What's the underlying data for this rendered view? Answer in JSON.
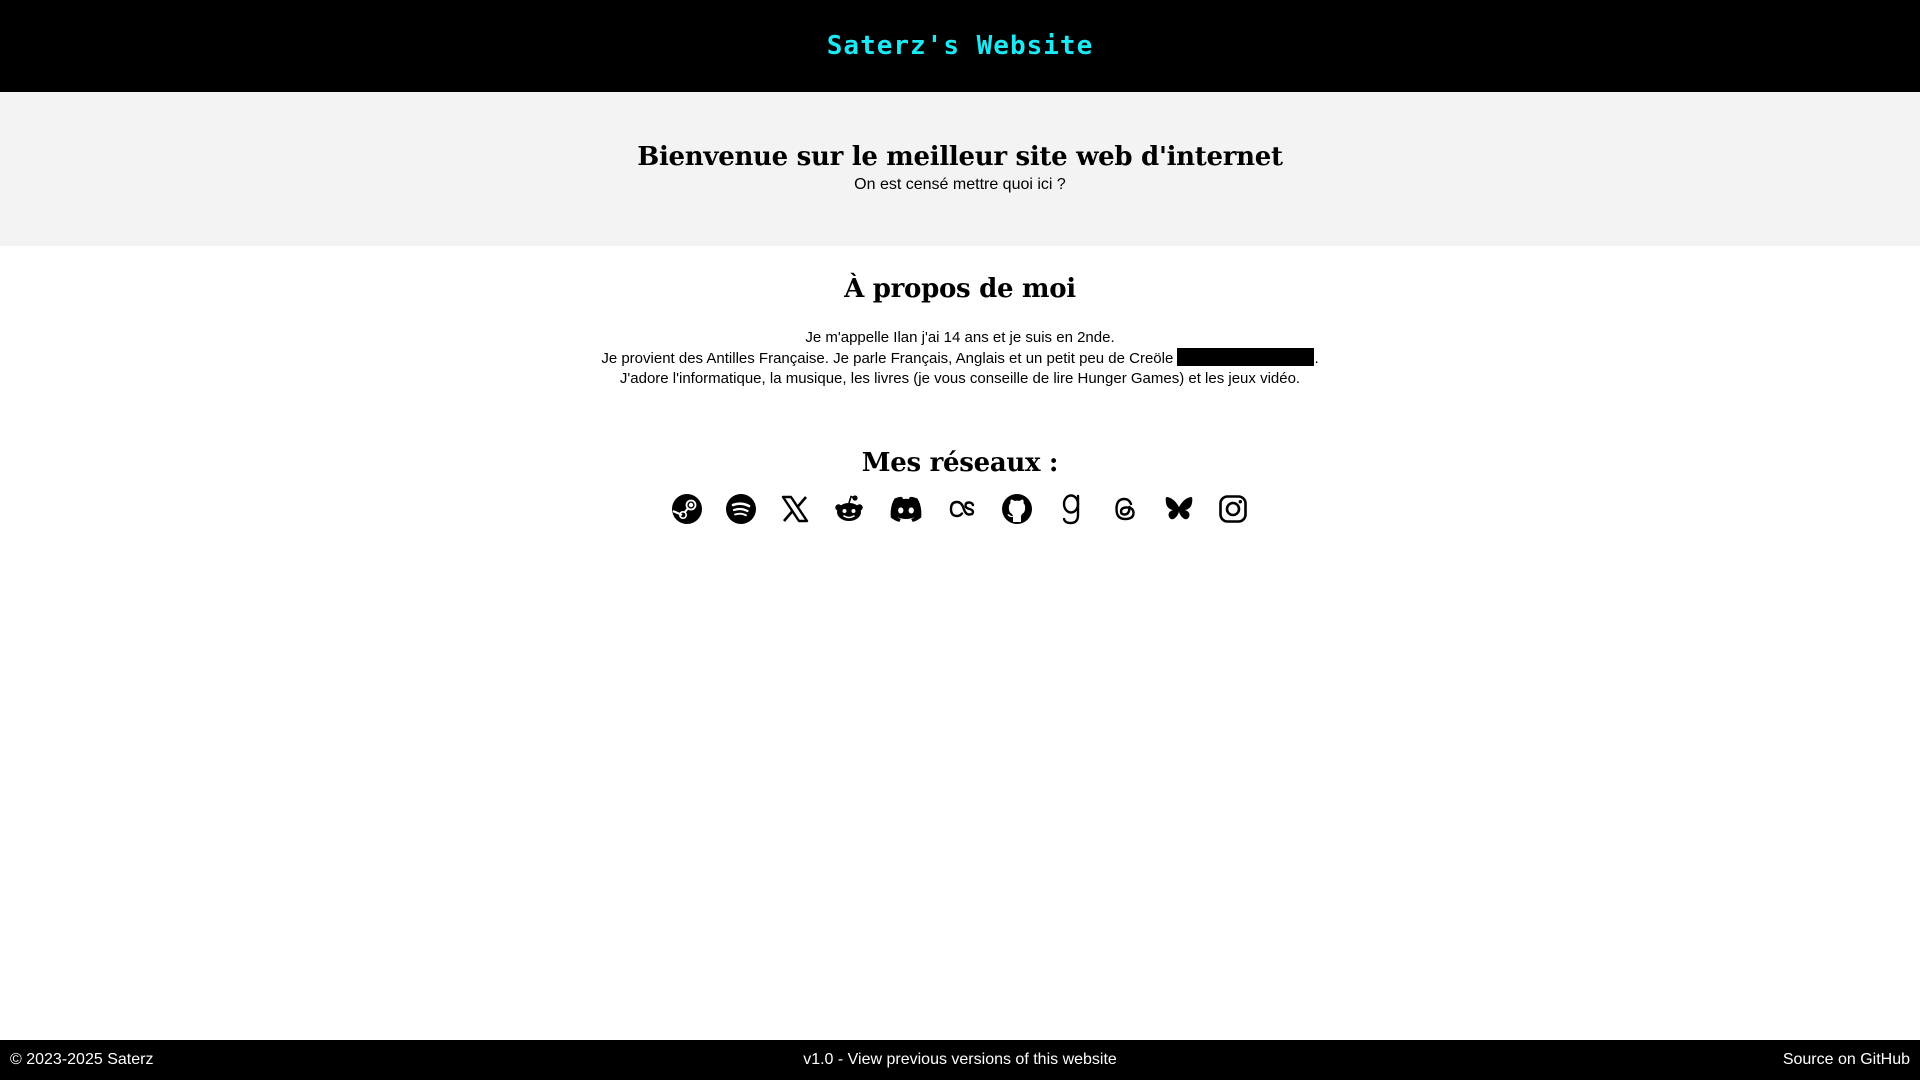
{
  "header": {
    "title": "Saterz's Website"
  },
  "hero": {
    "title": "Bienvenue sur le meilleur site web d'internet",
    "subtitle": "On est censé mettre quoi ici ?"
  },
  "about": {
    "title": "À propos de moi",
    "line1": "Je m'appelle Ilan j'ai 14 ans et je suis en 2nde.",
    "line2_before": "Je provient des Antilles Française. Je parle Français, Anglais et un petit peu de Creöle ",
    "line2_after": ".",
    "line3": "J'adore l'informatique, la musique, les livres (je vous conseille de lire Hunger Games) et les jeux vidéo."
  },
  "social": {
    "title": "Mes réseaux :",
    "icons": [
      "steam-icon",
      "spotify-icon",
      "x-icon",
      "reddit-icon",
      "discord-icon",
      "lastfm-icon",
      "github-icon",
      "goodreads-icon",
      "threads-icon",
      "bluesky-icon",
      "instagram-icon"
    ]
  },
  "footer": {
    "copyright": "© 2023-2025 Saterz",
    "versions": "v1.0 - View previous versions of this website",
    "source": "Source on GitHub"
  },
  "colors": {
    "title_accent": "#1de9f5",
    "hero_bg": "#f3f3f3",
    "bar_bg": "#000000"
  }
}
